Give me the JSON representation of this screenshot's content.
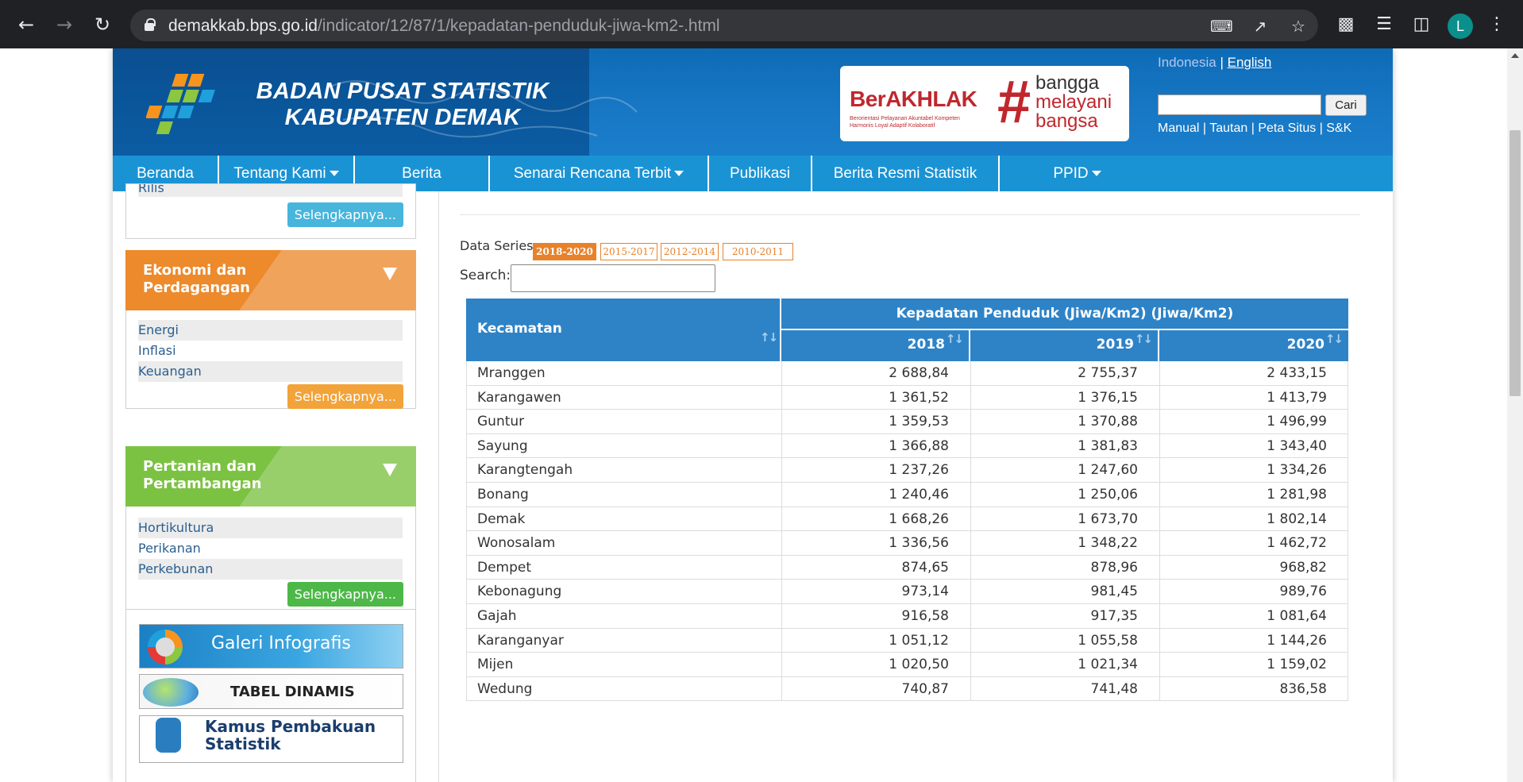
{
  "browser": {
    "url_host": "demakkab.bps.go.id",
    "url_path": "/indicator/12/87/1/kepadatan-penduduk-jiwa-km2-.html",
    "profile_initial": "L"
  },
  "header": {
    "title_line1": "BADAN PUSAT STATISTIK",
    "title_line2": "KABUPATEN DEMAK",
    "berakhlak_logo": "BerAKHLAK",
    "berakhlak_sub1": "Berorientasi Pelayanan Akuntabel Kompeten",
    "berakhlak_sub2": "Harmonis Loyal Adaptif Kolaboratif",
    "bangga_1": "bangga",
    "bangga_2": "melayani",
    "bangga_3": "bangsa",
    "lang_indonesia": "Indonesia",
    "lang_sep": " | ",
    "lang_english": "English",
    "search_button": "Cari",
    "toplinks": "Manual | Tautan | Peta Situs | S&K"
  },
  "nav": {
    "items": [
      "Beranda",
      "Tentang Kami",
      "Berita",
      "Senarai Rencana Terbit",
      "Publikasi",
      "Berita Resmi Statistik",
      "PPID"
    ]
  },
  "sidebar": {
    "cut_text": "Rilis",
    "more_label": "Selengkapnya...",
    "sections": [
      {
        "title_l1": "Ekonomi dan",
        "title_l2": "Perdagangan",
        "links": [
          "Energi",
          "Inflasi",
          "Keuangan"
        ]
      },
      {
        "title_l1": "Pertanian dan",
        "title_l2": "Pertambangan",
        "links": [
          "Hortikultura",
          "Perikanan",
          "Perkebunan"
        ]
      }
    ],
    "promos": [
      "Galeri Infografis",
      "TABEL DINAMIS",
      "Kamus Pembakuan",
      "Statistik"
    ]
  },
  "main": {
    "data_series_label": "Data Series :",
    "series": [
      "2018-2020",
      "2015-2017",
      "2012-2014",
      "2010-2011"
    ],
    "search_label": "Search:",
    "search_value": "",
    "table": {
      "col_region": "Kecamatan",
      "group_header": "Kepadatan Penduduk (Jiwa/Km2) (Jiwa/Km2)",
      "years": [
        "2018",
        "2019",
        "2020"
      ],
      "rows": [
        {
          "name": "Mranggen",
          "v": [
            "2 688,84",
            "2 755,37",
            "2 433,15"
          ]
        },
        {
          "name": "Karangawen",
          "v": [
            "1 361,52",
            "1 376,15",
            "1 413,79"
          ]
        },
        {
          "name": "Guntur",
          "v": [
            "1 359,53",
            "1 370,88",
            "1 496,99"
          ]
        },
        {
          "name": "Sayung",
          "v": [
            "1 366,88",
            "1 381,83",
            "1 343,40"
          ]
        },
        {
          "name": "Karangtengah",
          "v": [
            "1 237,26",
            "1 247,60",
            "1 334,26"
          ]
        },
        {
          "name": "Bonang",
          "v": [
            "1 240,46",
            "1 250,06",
            "1 281,98"
          ]
        },
        {
          "name": "Demak",
          "v": [
            "1 668,26",
            "1 673,70",
            "1 802,14"
          ]
        },
        {
          "name": "Wonosalam",
          "v": [
            "1 336,56",
            "1 348,22",
            "1 462,72"
          ]
        },
        {
          "name": "Dempet",
          "v": [
            "874,65",
            "878,96",
            "968,82"
          ]
        },
        {
          "name": "Kebonagung",
          "v": [
            "973,14",
            "981,45",
            "989,76"
          ]
        },
        {
          "name": "Gajah",
          "v": [
            "916,58",
            "917,35",
            "1 081,64"
          ]
        },
        {
          "name": "Karanganyar",
          "v": [
            "1 051,12",
            "1 055,58",
            "1 144,26"
          ]
        },
        {
          "name": "Mijen",
          "v": [
            "1 020,50",
            "1 021,34",
            "1 159,02"
          ]
        },
        {
          "name": "Wedung",
          "v": [
            "740,87",
            "741,48",
            "836,58"
          ]
        }
      ]
    }
  }
}
